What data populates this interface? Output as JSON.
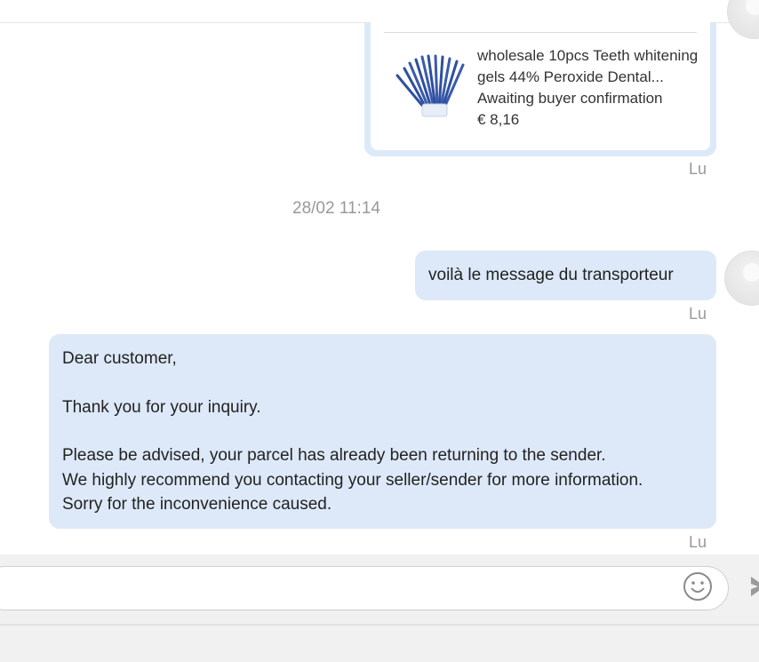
{
  "header": {
    "title": ""
  },
  "product": {
    "name": "wholesale 10pcs Teeth whitening gels 44% Peroxide Dental...",
    "status": "Awaiting buyer confirmation",
    "price": "€ 8,16",
    "sender": "Lu",
    "thumb_icon": "teeth-whitening-syringes-image"
  },
  "timestamp": "28/02 11:14",
  "messages": [
    {
      "text": "voilà le message du transporteur",
      "sender": "Lu"
    },
    {
      "lines": [
        "Dear customer,",
        "Thank you for your inquiry.",
        "Please be advised, your parcel has already been returning to the sender.",
        "We highly recommend you contacting your seller/sender for more information.",
        "Sorry for the inconvenience caused."
      ],
      "sender": "Lu"
    }
  ],
  "composer": {
    "placeholder": "",
    "emoji_icon": "smiley-icon",
    "send_icon": "send-icon"
  },
  "colors": {
    "bubble": "#dde9f8",
    "meta_text": "#999999",
    "composer_bg": "#f1f1f1"
  }
}
